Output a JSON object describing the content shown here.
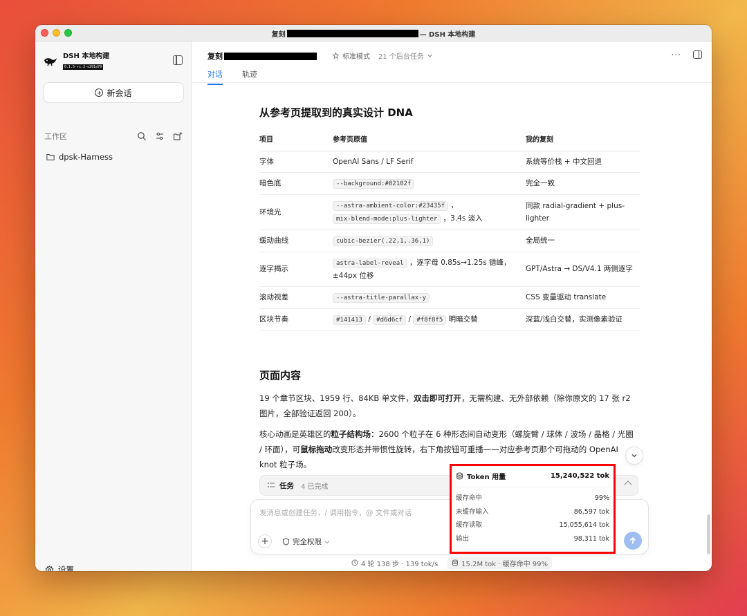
{
  "window": {
    "title_prefix": "复刻",
    "title_suffix": "— DSH 本地构建"
  },
  "sidebar": {
    "brand_name": "DSH 本地构建",
    "brand_version": "0.1.5-rc.2-c291a79",
    "new_chat_label": "新会话",
    "workspace_label": "工作区",
    "folders": [
      {
        "label": "dpsk-Harness"
      }
    ],
    "settings_label": "设置"
  },
  "header": {
    "title": "复刻",
    "mode_label": "标准模式",
    "bg_tasks_label": "21 个后台任务",
    "more_label": "···",
    "tabs": [
      {
        "label": "对话",
        "active": true
      },
      {
        "label": "轨迹",
        "active": false
      }
    ]
  },
  "content": {
    "dna_heading": "从参考页提取到的真实设计 DNA",
    "table": {
      "headers": [
        "项目",
        "参考页原值",
        "我的复刻"
      ],
      "rows": [
        {
          "item": "字体",
          "ref": [
            {
              "t": "text",
              "v": "OpenAI Sans / LF Serif"
            }
          ],
          "mine": "系统等价栈 + 中文回退"
        },
        {
          "item": "暗色底",
          "ref": [
            {
              "t": "code",
              "v": "--background:#02102f"
            }
          ],
          "mine": "完全一致"
        },
        {
          "item": "环境光",
          "ref": [
            {
              "t": "code",
              "v": "--astra-ambient-color:#23435f"
            },
            {
              "t": "text",
              "v": " ，"
            },
            {
              "t": "br"
            },
            {
              "t": "code",
              "v": "mix-blend-mode:plus-lighter"
            },
            {
              "t": "text",
              "v": " ，3.4s 淡入"
            }
          ],
          "mine": "同款 radial-gradient + plus-lighter"
        },
        {
          "item": "缓动曲线",
          "ref": [
            {
              "t": "code",
              "v": "cubic-bezier(.22,1,.36,1)"
            }
          ],
          "mine": "全局统一"
        },
        {
          "item": "逐字揭示",
          "ref": [
            {
              "t": "code",
              "v": "astra-label-reveal"
            },
            {
              "t": "text",
              "v": " ，逐字母 0.85s→1.25s 错峰，±44px 位移"
            }
          ],
          "mine": "GPT/Astra → DS/V4.1 两侧逐字"
        },
        {
          "item": "滚动视差",
          "ref": [
            {
              "t": "code",
              "v": "--astra-title-parallax-y"
            }
          ],
          "mine": "CSS 变量驱动 translate"
        },
        {
          "item": "区块节奏",
          "ref": [
            {
              "t": "code",
              "v": "#141413"
            },
            {
              "t": "text",
              "v": " / "
            },
            {
              "t": "code",
              "v": "#d6d6cf"
            },
            {
              "t": "text",
              "v": " / "
            },
            {
              "t": "code",
              "v": "#f8f8f5"
            },
            {
              "t": "text",
              "v": " 明暗交替"
            }
          ],
          "mine": "深蓝/浅白交替，实测像素验证"
        }
      ]
    },
    "page_heading": "页面内容",
    "para1": [
      {
        "t": "text",
        "v": "19 个章节区块、1959 行、84KB 单文件，"
      },
      {
        "t": "b",
        "v": "双击即可打开"
      },
      {
        "t": "text",
        "v": "，无需构建、无外部依赖（除你原文的 17 张 r2 图片，全部验证返回 200）。"
      }
    ],
    "para2": [
      {
        "t": "text",
        "v": "核心动画是英雄区的"
      },
      {
        "t": "b",
        "v": "粒子结构场"
      },
      {
        "t": "text",
        "v": "：2600 个粒子在 6 种形态间自动变形（螺旋臂 / 球体 / 波场 / 晶格 / 光圈 / 环面），可"
      },
      {
        "t": "b",
        "v": "鼠标拖动"
      },
      {
        "t": "text",
        "v": "改变形态并带惯性旋转，右下角按钮可重播——对应参考页那个可拖动的 OpenAI knot 粒子场。"
      }
    ]
  },
  "task_bar": {
    "label": "任务",
    "count": "4 已完成"
  },
  "composer": {
    "placeholder": "发消息或创建任务，/ 调用指令，@ 文件或对话",
    "permission_label": "完全权限"
  },
  "status": {
    "steps": "4 轮 138 步 · 139 tok/s",
    "tokens": "15.2M tok · 缓存命中 99%"
  },
  "token_popover": {
    "title": "Token 用量",
    "total": "15,240,522 tok",
    "rows": [
      {
        "label": "缓存命中",
        "value": "99%"
      },
      {
        "label": "未缓存输入",
        "value": "86,597 tok"
      },
      {
        "label": "缓存读取",
        "value": "15,055,614 tok"
      },
      {
        "label": "输出",
        "value": "98,311 tok"
      }
    ],
    "highlight_color": "#ff0000"
  },
  "colors": {
    "accent": "#1a73e8",
    "send_button": "#9fbdf0"
  }
}
